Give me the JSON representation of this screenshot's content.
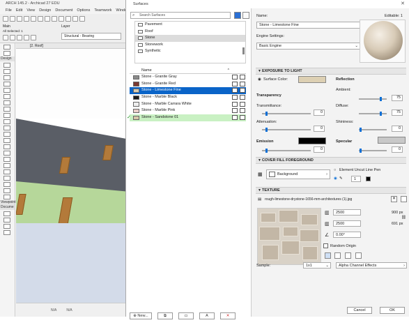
{
  "background_app": {
    "title": "ARCH 145.2 - Archicad 27 EDU",
    "menus": [
      "File",
      "Edit",
      "View",
      "Design",
      "Document",
      "Options",
      "Teamwork",
      "Windo"
    ],
    "tab": "[2. Roof]",
    "toolbar": {
      "main_label": "Main",
      "layer_label": "Layer",
      "all_selected": "All Selected: 1",
      "layer_value": "Structural - Bearing"
    },
    "toolbox_sections": [
      "Design",
      "Viewpoint",
      "Docume"
    ],
    "status": [
      "N/A",
      "N/A"
    ]
  },
  "dialog": {
    "title": "Surfaces",
    "search_placeholder": "Search Surfaces",
    "folders": [
      "Pavement",
      "Roof",
      "Stone",
      "Stonework",
      "Synthetic"
    ],
    "selected_folder": "Stone",
    "list_header": "Name",
    "surfaces": [
      {
        "name": "Stone - Granite Gray",
        "color": "#8b8b8b",
        "state": ""
      },
      {
        "name": "Stone - Granite Red",
        "color": "#7a3a32",
        "state": ""
      },
      {
        "name": "Stone - Limestone Fine",
        "color": "#d8ccb4",
        "state": "selected"
      },
      {
        "name": "Stone - Marble Black",
        "color": "#1c1c1c",
        "state": ""
      },
      {
        "name": "Stone - Marble Carrara White",
        "color": "#eeeeee",
        "state": ""
      },
      {
        "name": "Stone - Marble Pink",
        "color": "#e9cfc9",
        "state": ""
      },
      {
        "name": "Stone - Sandstone 01",
        "color": "#d6c6a8",
        "state": "active"
      }
    ],
    "bottom_buttons": [
      "New...",
      "",
      "",
      "A",
      "✕"
    ],
    "name_label": "Name:",
    "editable": "Editable: 1",
    "name_value": "Stone - Limestone Fine",
    "engine_label": "Engine Settings:",
    "engine_value": "Basic Engine",
    "exposure": {
      "title": "EXPOSURE TO LIGHT",
      "surface_color_label": "Surface Color:",
      "surface_color": "#ddd0b3",
      "transparency": "Transparency",
      "transmittance": "Transmittance:",
      "transmittance_val": "0",
      "attenuation": "Attenuation:",
      "attenuation_val": "0",
      "emission": "Emission",
      "emission_val": "0",
      "emission_color": "#000000",
      "reflection": "Reflection",
      "ambient": "Ambient:",
      "ambient_val": "75",
      "diffuse": "Diffuse:",
      "diffuse_val": "75",
      "shininess": "Shininess:",
      "shininess_val": "0",
      "specular": "Specular",
      "specular_val": "0",
      "specular_color": "#c8c8c8"
    },
    "cover_fill": {
      "title": "COVER FILL FOREGROUND",
      "background_label": "Background",
      "element_uncut": "Element Uncut Line Pen",
      "pen_value": "1"
    },
    "texture": {
      "title": "TEXTURE",
      "file": "rough-limestone-drystone-1656-mm-architextures (1).jpg",
      "width": "2500",
      "height": "2500",
      "width_px": "900 px",
      "height_px": "691 px",
      "angle": "0.00°",
      "random_origin": "Random Origin",
      "sample_label": "Sample:",
      "sample_value": "1x1",
      "alpha": "Alpha Channel Effects"
    },
    "cancel": "Cancel",
    "ok": "OK"
  }
}
